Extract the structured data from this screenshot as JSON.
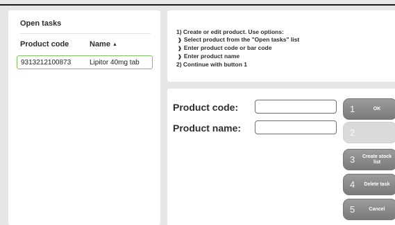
{
  "open_tasks": {
    "title": "Open tasks",
    "columns": {
      "code": "Product code",
      "name": "Name"
    },
    "sort_icon": "sort-ascending-icon",
    "rows": [
      {
        "code": "9313212100873",
        "name": "Lipitor 40mg tab"
      }
    ],
    "selected_border_color": "#7ec261"
  },
  "instructions": {
    "line1": "1) Create or edit product. Use options:",
    "bullets": [
      "Select product from the \"Open tasks\" list",
      "Enter product code or bar code",
      "Enter product name"
    ],
    "bullet_icon": "double-chevron-right-icon",
    "line2": "2) Continue with button 1"
  },
  "form": {
    "code_label": "Product code:",
    "name_label": "Product name:",
    "code_value": "",
    "name_value": ""
  },
  "buttons": [
    {
      "number": "1",
      "label": "OK",
      "enabled": true
    },
    {
      "number": "2",
      "label": "",
      "enabled": false
    },
    {
      "number": "3",
      "label": "Create stock list",
      "enabled": true
    },
    {
      "number": "4",
      "label": "Delete task",
      "enabled": true
    },
    {
      "number": "5",
      "label": "Cancel",
      "enabled": true
    }
  ],
  "colors": {
    "background": "#e6e6e6",
    "panel": "#ffffff",
    "button": "#8a8a8a",
    "button_disabled": "#dadada"
  }
}
